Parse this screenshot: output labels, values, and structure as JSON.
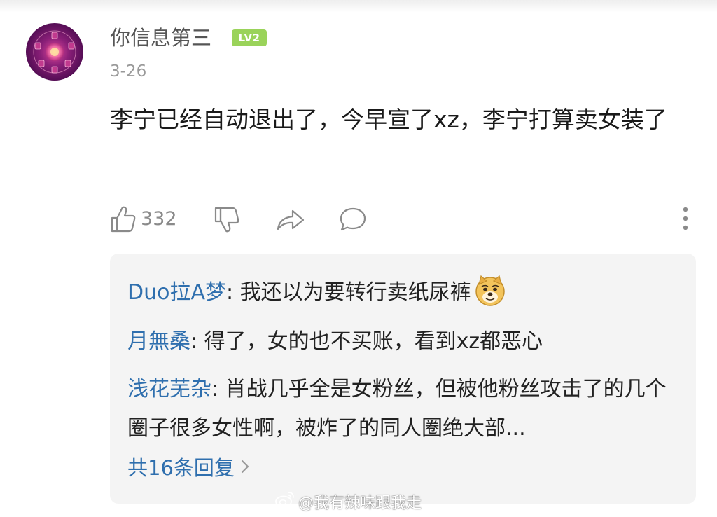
{
  "comment": {
    "username": "你信息第三",
    "level_badge": "LV2",
    "date": "3-26",
    "text": "李宁已经自动退出了，今早宣了xz，李宁打算卖女装了",
    "like_count": "332",
    "icons": [
      "thumbs-up-icon",
      "thumbs-down-icon",
      "share-icon",
      "comment-icon",
      "more-icon"
    ]
  },
  "replies": {
    "items": [
      {
        "author": "Duo拉A梦",
        "separator": ": ",
        "text": "我还以为要转行卖纸尿裤",
        "emoji": "doge-emoji"
      },
      {
        "author": "月無桑",
        "separator": ": ",
        "text": "得了，女的也不买账，看到xz都恶心"
      },
      {
        "author": "浅花芜杂",
        "separator": ": ",
        "text": "肖战几乎全是女粉丝，但被他粉丝攻击了的几个圈子很多女性啊，被炸了的同人圈绝大部..."
      }
    ],
    "more_label": "共16条回复"
  },
  "watermark": "@我有辣味跟我走",
  "colors": {
    "reply_author": "#2f6fae",
    "badge": "#9ad35a",
    "reply_bg": "#f4f4f4"
  }
}
